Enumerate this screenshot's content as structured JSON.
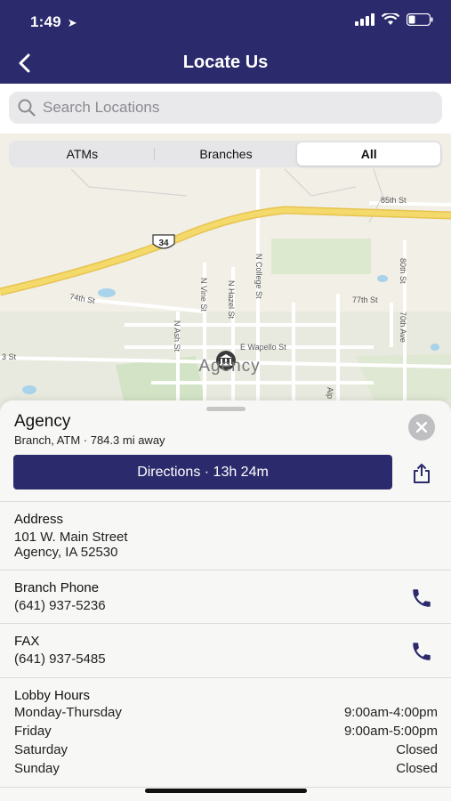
{
  "status": {
    "time": "1:49"
  },
  "nav": {
    "title": "Locate Us"
  },
  "search": {
    "placeholder": "Search Locations",
    "value": ""
  },
  "filter": {
    "options": [
      "ATMs",
      "Branches",
      "All"
    ],
    "selected": "All"
  },
  "map": {
    "labels": {
      "highway": "34",
      "st85": "85th St",
      "st74": "74th St",
      "st77": "77th St",
      "ncollege": "N College St",
      "nvine": "N Vine St",
      "nhazel": "N Hazel St",
      "nash": "N Ash St",
      "ewapello": "E Wapello St",
      "st80": "80th St",
      "ave70": "70th Ave",
      "alpine": "Alp",
      "stleft": "3 St",
      "town": "Agency"
    }
  },
  "location": {
    "name": "Agency",
    "meta": "Branch, ATM · 784.3 mi away",
    "directions_label": "Directions · 13h 24m",
    "address_title": "Address",
    "address_line1": "101 W. Main Street",
    "address_line2": "Agency, IA 52530",
    "phone_title": "Branch Phone",
    "phone": "(641) 937-5236",
    "fax_title": "FAX",
    "fax": "(641) 937-5485",
    "hours_title": "Lobby Hours",
    "hours": [
      {
        "day": "Monday-Thursday",
        "time": "9:00am-4:00pm"
      },
      {
        "day": "Friday",
        "time": "9:00am-5:00pm"
      },
      {
        "day": "Saturday",
        "time": "Closed"
      },
      {
        "day": "Sunday",
        "time": "Closed"
      }
    ]
  },
  "colors": {
    "brand": "#2b2a6c",
    "map_bg": "#f1efe6",
    "highway": "#f4d96b"
  }
}
